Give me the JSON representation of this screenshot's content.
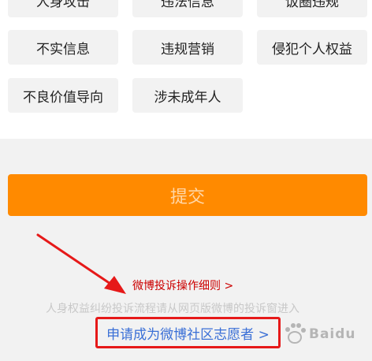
{
  "categories": [
    {
      "label": "人身攻击"
    },
    {
      "label": "违法信息"
    },
    {
      "label": "饭圈违规"
    },
    {
      "label": "不实信息"
    },
    {
      "label": "违规营销"
    },
    {
      "label": "侵犯个人权益"
    },
    {
      "label": "不良价值导向"
    },
    {
      "label": "涉未成年人"
    }
  ],
  "submit": {
    "label": "提交"
  },
  "links": {
    "rules": "微博投诉操作细则 >",
    "hint": "人身权益纠纷投诉流程请从网页版微博的投诉窗进入",
    "volunteer": "申请成为微博社区志愿者 >"
  },
  "watermark": {
    "text": "Baidu"
  },
  "colors": {
    "accent_orange": "#ff8a00",
    "link_red": "#cc0000",
    "link_blue": "#3a6fd6",
    "annotation_red": "#e61919"
  }
}
